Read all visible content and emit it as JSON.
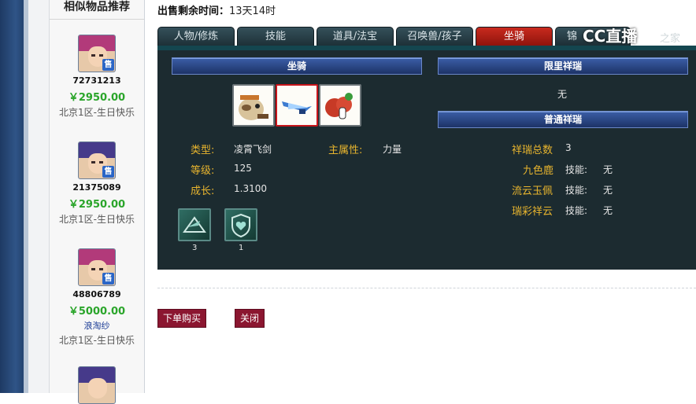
{
  "sidebar": {
    "title": "相似物品推荐",
    "items": [
      {
        "id": "72731213",
        "price": "￥2950.00",
        "note": "",
        "server": "北京1区-生日快乐",
        "hair": "#b23a7a"
      },
      {
        "id": "21375089",
        "price": "￥2950.00",
        "note": "",
        "server": "北京1区-生日快乐",
        "hair": "#463a8a"
      },
      {
        "id": "48806789",
        "price": "￥5000.00",
        "note": "浪淘纱",
        "server": "北京1区-生日快乐",
        "hair": "#b23a7a"
      },
      {
        "id": "",
        "price": "",
        "note": "",
        "server": "",
        "hair": "#463a8a"
      }
    ],
    "sale_badge": "售"
  },
  "header": {
    "sell_time_label": "出售剩余时间：",
    "sell_time_value": "13天14时"
  },
  "tabs": [
    {
      "label": "人物/修炼",
      "active": false
    },
    {
      "label": "技能",
      "active": false
    },
    {
      "label": "道具/法宝",
      "active": false
    },
    {
      "label": "召唤兽/孩子",
      "active": false
    },
    {
      "label": "坐骑",
      "active": true
    },
    {
      "label": "锦",
      "active": false
    }
  ],
  "mount": {
    "section_title": "坐骑",
    "type_label": "类型:",
    "type_value": "凌霄飞剑",
    "main_attr_label": "主属性:",
    "main_attr_value": "力量",
    "level_label": "等级:",
    "level_value": "125",
    "growth_label": "成长:",
    "growth_value": "1.3100",
    "skills": [
      {
        "icon": "shield-arrow-icon",
        "count": "3"
      },
      {
        "icon": "heart-shield-icon",
        "count": "1"
      }
    ],
    "slot_icons": [
      "horse-mount-icon",
      "flying-sword-icon",
      "red-orb-icon"
    ]
  },
  "limited_xiangrui": {
    "title": "限里祥瑞",
    "value": "无"
  },
  "normal_xiangrui": {
    "title": "普通祥瑞",
    "total_label": "祥瑞总数",
    "total_value": "3",
    "items": [
      {
        "name": "九色鹿",
        "skill_label": "技能:",
        "skill_value": "无"
      },
      {
        "name": "流云玉佩",
        "skill_label": "技能:",
        "skill_value": "无"
      },
      {
        "name": "瑞彩祥云",
        "skill_label": "技能:",
        "skill_value": "无"
      }
    ]
  },
  "actions": {
    "buy_label": "下单购买",
    "close_label": "关闭"
  },
  "watermark": {
    "text": "CC直播",
    "suffix": "之家"
  }
}
